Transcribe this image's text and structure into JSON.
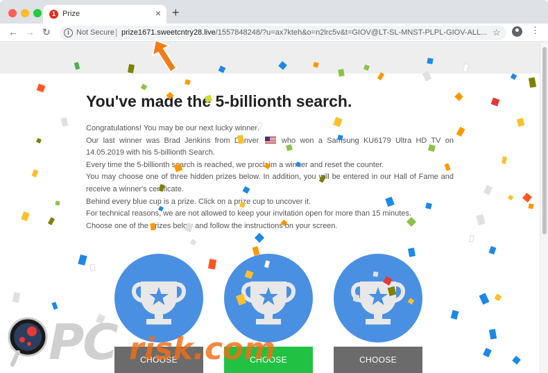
{
  "browser": {
    "tab_title": "Prize",
    "tab_badge": "1",
    "new_tab": "+",
    "security_label": "Not Secure",
    "url_host": "prize1671.sweetcntry28.live",
    "url_rest": "/1557848248/?u=ax7kteh&o=n2lrc5v&t=GIOV@LT-SL-MNST-PLPL-GIOV-ALL..."
  },
  "page": {
    "headline": "You've made the 5-billionth search.",
    "paragraphs": {
      "p1": "Congratulations! You may be our next lucky winner!",
      "p2a": "Our last winner was Brad Jenkins from Denver",
      "p2b": "who won a Samsung KU6179 Ultra HD TV on 14.05.2019 with his 5-billionth Search.",
      "p3": "Every time the 5-billionth search is reached, we proclaim a winner and reset the counter.",
      "p4": "You may choose one of three hidden prizes below. In addition, you will be entered in our Hall of Fame and receive a winner's certificate.",
      "p5": "Behind every blue cup is a prize. Click on a prize cup to uncover it.",
      "p6": "For technical reasons, we are not allowed to keep your invitation open for more than 15 minutes.",
      "p7": "Choose one of the prizes below and follow the instructions on your screen."
    },
    "buttons": {
      "choose_1": "CHOOSE",
      "choose_2": "CHOOSE",
      "choose_3": "CHOOSE"
    }
  },
  "watermark": {
    "text_pc": "PC",
    "text_risk": "risk.com"
  },
  "colors": {
    "cup_blue": "#4a90e2",
    "choose_green": "#21c243",
    "choose_gray": "#6b6b6b",
    "arrow_orange": "#f07d1a"
  }
}
